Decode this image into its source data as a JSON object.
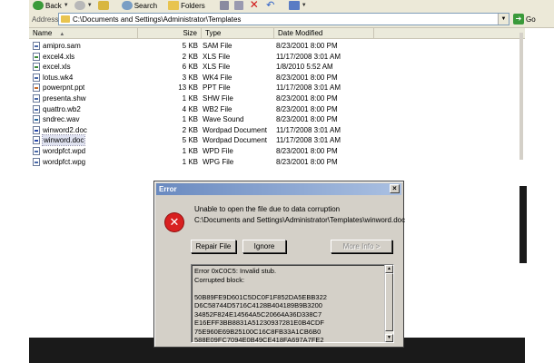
{
  "toolbar": {
    "back_label": "Back",
    "search_label": "Search",
    "folders_label": "Folders"
  },
  "address": {
    "label": "Address",
    "value": "C:\\Documents and Settings\\Administrator\\Templates",
    "go_label": "Go"
  },
  "columns": {
    "name": "Name",
    "size": "Size",
    "type": "Type",
    "date": "Date Modified"
  },
  "files": [
    {
      "name": "amipro.sam",
      "size": "5 KB",
      "type": "SAM File",
      "date": "8/23/2001 8:00 PM",
      "icon_color": "#4a6aaa"
    },
    {
      "name": "excel4.xls",
      "size": "2 KB",
      "type": "XLS File",
      "date": "11/17/2008 3:01 AM",
      "icon_color": "#3a8a3a"
    },
    {
      "name": "excel.xls",
      "size": "6 KB",
      "type": "XLS File",
      "date": "1/8/2010 5:52 AM",
      "icon_color": "#3a8a3a"
    },
    {
      "name": "lotus.wk4",
      "size": "3 KB",
      "type": "WK4 File",
      "date": "8/23/2001 8:00 PM",
      "icon_color": "#4a6aaa"
    },
    {
      "name": "powerpnt.ppt",
      "size": "13 KB",
      "type": "PPT File",
      "date": "11/17/2008 3:01 AM",
      "icon_color": "#c86a2a"
    },
    {
      "name": "presenta.shw",
      "size": "1 KB",
      "type": "SHW File",
      "date": "8/23/2001 8:00 PM",
      "icon_color": "#4a6aaa"
    },
    {
      "name": "quattro.wb2",
      "size": "4 KB",
      "type": "WB2 File",
      "date": "8/23/2001 8:00 PM",
      "icon_color": "#4a6aaa"
    },
    {
      "name": "sndrec.wav",
      "size": "1 KB",
      "type": "Wave Sound",
      "date": "8/23/2001 8:00 PM",
      "icon_color": "#2a6aa0"
    },
    {
      "name": "winword2.doc",
      "size": "2 KB",
      "type": "Wordpad Document",
      "date": "11/17/2008 3:01 AM",
      "icon_color": "#2a4aaa"
    },
    {
      "name": "winword.doc",
      "size": "5 KB",
      "type": "Wordpad Document",
      "date": "11/17/2008 3:01 AM",
      "icon_color": "#2a4aaa"
    },
    {
      "name": "wordpfct.wpd",
      "size": "1 KB",
      "type": "WPD File",
      "date": "8/23/2001 8:00 PM",
      "icon_color": "#4a6aaa"
    },
    {
      "name": "wordpfct.wpg",
      "size": "1 KB",
      "type": "WPG File",
      "date": "8/23/2001 8:00 PM",
      "icon_color": "#4a6aaa"
    }
  ],
  "dialog": {
    "title": "Error",
    "close_glyph": "×",
    "message": "Unable to open the file due to data corruption",
    "path": "C:\\Documents and Settings\\Administrator\\Templates\\winword.doc",
    "buttons": {
      "repair": "Repair File",
      "ignore": "Ignore",
      "more_info": "More Info >"
    },
    "details_lines": [
      "Error 0xC0C5: Invalid stub.",
      "Corrupted block:",
      "",
      "50B89FE9D601C5DC0F1F852DA5EBB322",
      "D6C58744D5716C4128B404189B9B3200",
      "34852F824E14564A5C20664A36D338C7",
      "E16EFF3BB8831A51230937281E0B4CDF",
      "75E960E69B25100C16C8FB33A1CB6B0",
      "588E09FC7094E0B49CE418FA697A7FE2"
    ]
  }
}
